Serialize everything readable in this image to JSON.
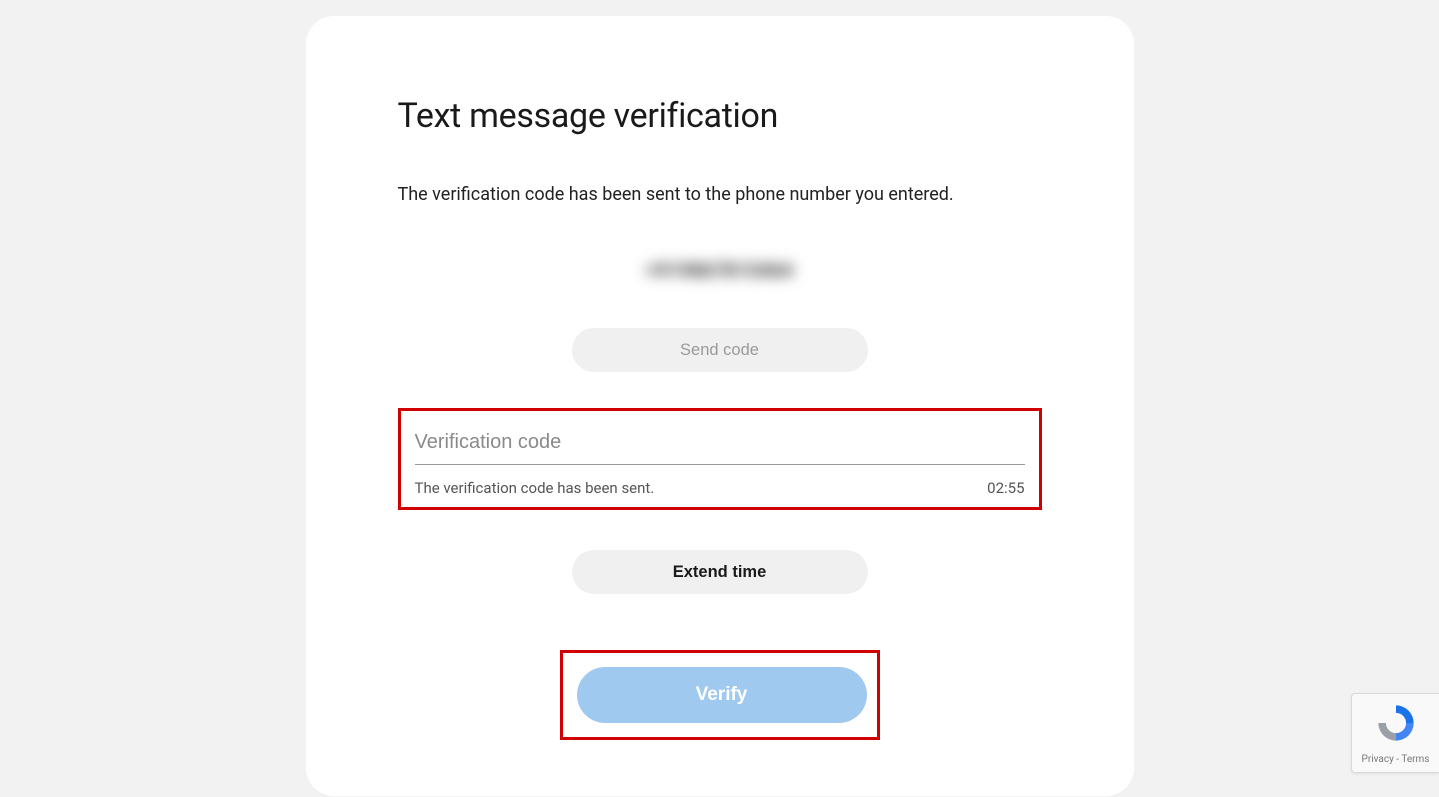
{
  "page": {
    "title": "Text message verification",
    "subtitle": "The verification code has been sent to the phone number you entered.",
    "phone_masked": "+919867815464"
  },
  "buttons": {
    "send_code": "Send code",
    "extend_time": "Extend time",
    "verify": "Verify"
  },
  "code_field": {
    "placeholder": "Verification code",
    "status_message": "The verification code has been sent.",
    "countdown": "02:55"
  },
  "recaptcha": {
    "privacy_label": "Privacy",
    "separator": " - ",
    "terms_label": "Terms"
  }
}
